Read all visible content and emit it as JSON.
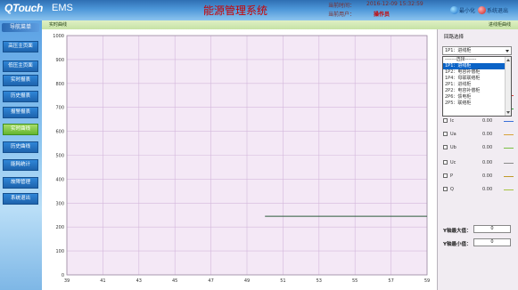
{
  "header": {
    "logo": "QTouch",
    "ems": "EMS",
    "title": "能源管理系统",
    "time_label": "当前时间：",
    "time_value": "2016-12-09 15:32:59",
    "user_label": "当前用户：",
    "user_value": "操作员",
    "minimize_label": "最小化",
    "quit_label": "系统退出"
  },
  "nav": {
    "title": "导航菜单",
    "items": [
      "高压主页面",
      "低压主页面",
      "实时报表",
      "历史报表",
      "报警报表",
      "实时曲线",
      "历史曲线",
      "能耗统计",
      "故障管理",
      "系统退出"
    ],
    "active_index": 5
  },
  "tabs": {
    "realtime": "实时曲线",
    "energy": "进线柜曲线"
  },
  "panel": {
    "section_title": "回路选择",
    "selected": "1P1：进线柜",
    "options": [
      "-------选择-------",
      "1P1：进线柜",
      "1P2：电容补偿柜",
      "1P4：母联联络柜",
      "2P1：进线柜",
      "2P2：电容补偿柜",
      "2P6：馈电柜",
      "2P5：联络柜"
    ],
    "highlight_index": 1,
    "params": [
      {
        "name": "Ia",
        "value": "0.00",
        "color": "#d83a3a"
      },
      {
        "name": "Ib",
        "value": "0.00",
        "color": "#31a33a"
      },
      {
        "name": "Ic",
        "value": "0.00",
        "color": "#3a6fd8"
      },
      {
        "name": "Ua",
        "value": "0.00",
        "color": "#d8a33a"
      },
      {
        "name": "Ub",
        "value": "0.00",
        "color": "#7ac043"
      },
      {
        "name": "Uc",
        "value": "0.00",
        "color": "#8a8a8a"
      },
      {
        "name": "P",
        "value": "0.00",
        "color": "#c09a2a"
      },
      {
        "name": "Q",
        "value": "0.00",
        "color": "#a7c441"
      }
    ],
    "y_max_label": "Y轴最大值：",
    "y_max_value": "0",
    "y_min_label": "Y轴最小值：",
    "y_min_value": "0"
  },
  "chart_data": {
    "type": "line",
    "title": "",
    "xlabel": "",
    "ylabel": "",
    "xlim": [
      39,
      59
    ],
    "ylim": [
      0,
      1000
    ],
    "x_ticks": [
      39,
      41,
      43,
      45,
      47,
      49,
      51,
      53,
      55,
      57,
      59
    ],
    "y_ticks": [
      0,
      100,
      200,
      300,
      400,
      500,
      600,
      700,
      800,
      900,
      1000
    ],
    "grid": true,
    "series": [
      {
        "color": "#2a5a3a",
        "x": [
          50.0,
          59
        ],
        "y": [
          245,
          245
        ]
      }
    ]
  }
}
